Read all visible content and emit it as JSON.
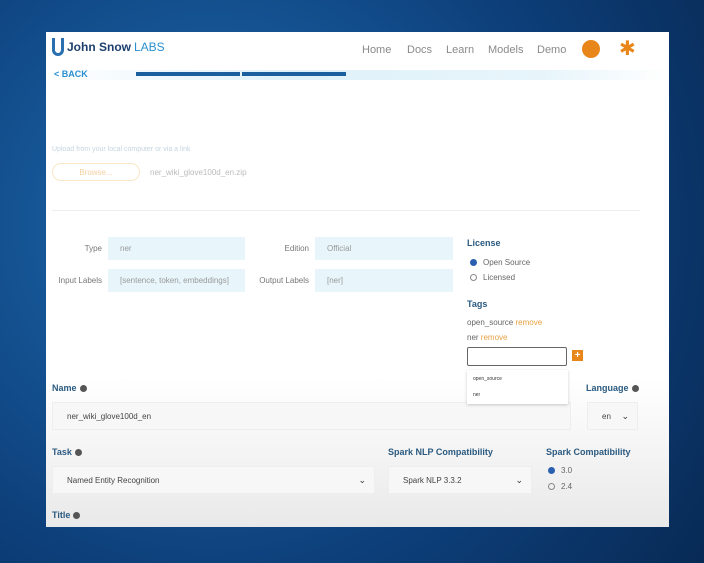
{
  "header": {
    "logo_main": "John Snow",
    "logo_suffix": "LABS",
    "nav": [
      "Home",
      "Docs",
      "Learn",
      "Models",
      "Demo"
    ],
    "github_icon": "github-icon",
    "slack_icon": "slack-icon",
    "accent": "#e8861a"
  },
  "back": "< BACK",
  "upload": {
    "hint": "Upload from your local computer or via a link",
    "browse": "Browse...",
    "filename": "ner_wiki_glove100d_en.zip"
  },
  "fields": {
    "type_label": "Type",
    "type_value": "ner",
    "edition_label": "Edition",
    "edition_value": "Official",
    "input_labels_label": "Input Labels",
    "input_labels_value": "[sentence, token, embeddings]",
    "output_labels_label": "Output Labels",
    "output_labels_value": "[ner]"
  },
  "license": {
    "title": "License",
    "options": [
      "Open Source",
      "Licensed"
    ],
    "selected": "Open Source"
  },
  "tags": {
    "title": "Tags",
    "items": [
      {
        "name": "open_source",
        "action": "remove"
      },
      {
        "name": "ner",
        "action": "remove"
      }
    ],
    "input_value": "",
    "suggestions": [
      "open_source",
      "ner"
    ]
  },
  "name": {
    "label": "Name",
    "value": "ner_wiki_glove100d_en"
  },
  "language": {
    "label": "Language",
    "value": "en"
  },
  "task": {
    "label": "Task",
    "value": "Named Entity Recognition"
  },
  "spark_nlp": {
    "label": "Spark NLP Compatibility",
    "value": "Spark NLP 3.3.2"
  },
  "spark": {
    "label": "Spark Compatibility",
    "options": [
      "3.0",
      "2.4"
    ],
    "selected": "3.0"
  },
  "title_field": {
    "label": "Title"
  }
}
